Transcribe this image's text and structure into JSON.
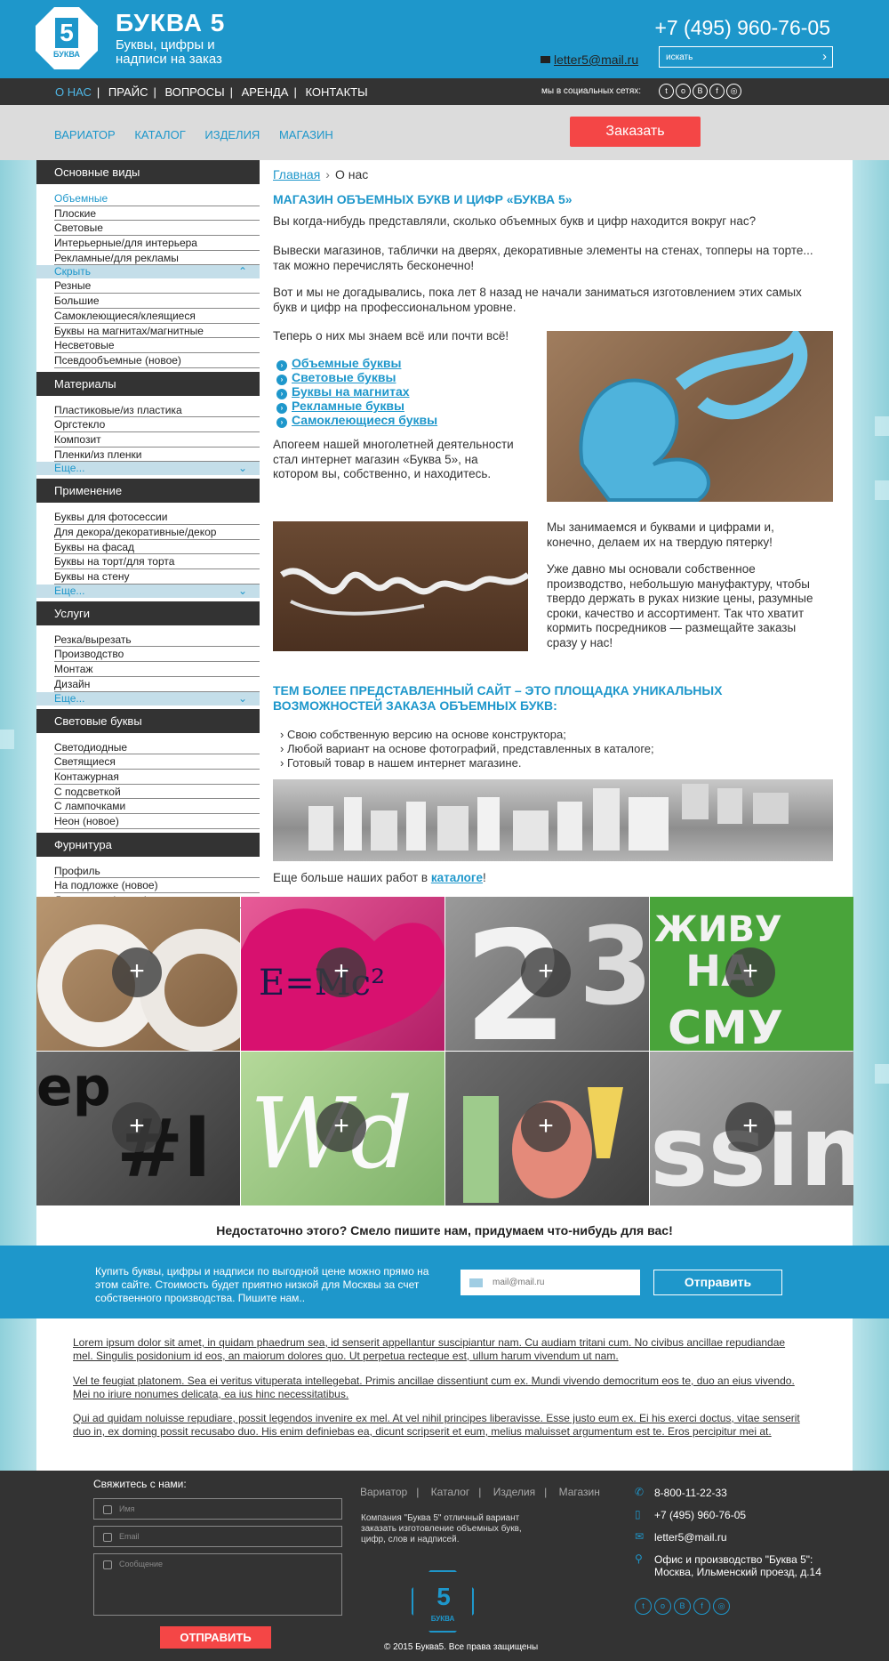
{
  "header": {
    "brand_title": "БУКВА 5",
    "brand_subtitle": "Буквы, цифры и надписи на заказ",
    "logo_digit": "5",
    "logo_label": "БУКВА",
    "phone": "+7 (495) 960-76-05",
    "email": "letter5@mail.ru",
    "search_placeholder": "искать"
  },
  "topnav": {
    "items": [
      "О НАС",
      "ПРАЙС",
      "ВОПРОСЫ",
      "АРЕНДА",
      "КОНТАКТЫ"
    ],
    "social_label": "мы в социальных сетях:",
    "social": [
      "t",
      "о",
      "В",
      "f",
      "◎"
    ]
  },
  "subnav": {
    "items": [
      "ВАРИАТОР",
      "КАТАЛОГ",
      "ИЗДЕЛИЯ",
      "МАГАЗИН"
    ],
    "order": "Заказать"
  },
  "sidebar": {
    "sections": [
      {
        "title": "Основные виды",
        "items": [
          "Объемные",
          "Плоские",
          "Световые",
          "Интерьерные/для интерьера",
          "Рекламные/для рекламы"
        ],
        "more": "Скрыть",
        "extra": [
          "Резные",
          "Большие",
          "Самоклеющиеся/клеящиеся",
          "Буквы на магнитах/магнитные",
          "Несветовые",
          "Псевдообъемные (новое)"
        ]
      },
      {
        "title": "Материалы",
        "items": [
          "Пластиковые/из пластика",
          "Оргстекло",
          "Композит",
          "Пленки/из пленки"
        ],
        "more": "Еще..."
      },
      {
        "title": "Применение",
        "items": [
          "Буквы для фотосессии",
          "Для декора/декоративные/декор",
          "Буквы на фасад",
          "Буквы на торт/для торта",
          "Буквы на стену"
        ],
        "more": "Еще..."
      },
      {
        "title": "Услуги",
        "items": [
          "Резка/вырезать",
          "Производство",
          "Монтаж",
          "Дизайн"
        ],
        "more": "Еще..."
      },
      {
        "title": "Световые буквы",
        "items": [
          "Светодиодные",
          "Светящиеся",
          "Контажурная",
          "С подсветкой",
          "С лампочками",
          "Неон (новое)"
        ]
      },
      {
        "title": "Фурнитура",
        "items": [
          "Профиль",
          "На подложке (новое)",
          "Держатели (новое)"
        ]
      }
    ]
  },
  "main": {
    "breadcrumb_home": "Главная",
    "breadcrumb_sep": "›",
    "breadcrumb_current": "О нас",
    "heading": "МАГАЗИН ОБЪЕМНЫХ БУКВ И ЦИФР «БУКВА 5»",
    "p1": "Вы когда-нибудь представляли, сколько объемных букв и цифр находится вокруг нас?",
    "p2": "Вывески магазинов, таблички на дверях, декоративные элементы на стенах, топперы на торте... так можно перечислять бесконечно!",
    "p3": "Вот и мы не догадывались, пока лет 8 назад не начали заниматься изготовлением этих самых букв и цифр на профессиональном уровне.",
    "p4": "Теперь о них мы знаем всё или почти всё!",
    "links": [
      "Объемные буквы",
      "Световые буквы",
      "Буквы на магнитах",
      "Рекламные буквы",
      "Самоклеющиеся буквы"
    ],
    "p5": "Апогеем нашей многолетней деятельности стал интернет магазин «Буква 5», на котором вы, собственно, и находитесь.",
    "p6": "Мы занимаемся и буквами и цифрами и, конечно, делаем их на твердую пятерку!",
    "p7": "Уже давно мы основали собственное производство, небольшую мануфактуру, чтобы твердо держать в руках низкие цены, разумные сроки, качество и ассортимент. Так что хватит кормить посредников — размещайте заказы сразу у нас!",
    "heading2": "ТЕМ БОЛЕЕ ПРЕДСТАВЛЕННЫЙ САЙТ – ЭТО ПЛОЩАДКА УНИКАЛЬНЫХ ВОЗМОЖНОСТЕЙ ЗАКАЗА ОБЪЕМНЫХ БУКВ:",
    "bullets": [
      "Свою собственную версию на основе конструктора;",
      "Любой вариант на основе фотографий, представленных в каталоге;",
      "Готовый товар в нашем интернет магазине."
    ],
    "catalog_text": "Еще больше наших работ в ",
    "catalog_link": "каталоге",
    "catalog_end": "!"
  },
  "gallery": {
    "plus": "+",
    "cta": "Недостаточно этого? Смело пишите нам, придумаем что-нибудь для вас!"
  },
  "band": {
    "text": "Купить буквы, цифры и надписи по выгодной цене можно прямо на этом сайте. Стоимость будет приятно низкой для Москвы за счет собственного производства. Пишите нам..",
    "placeholder": "mail@mail.ru",
    "button": "Отправить"
  },
  "lorem": [
    "Lorem ipsum dolor sit amet, in quidam phaedrum sea, id senserit appellantur suscipiantur nam. Cu audiam tritani cum. No civibus ancillae repudiandae mel. Singulis posidonium id eos, an maiorum dolores quo. Ut perpetua recteque est, ullum harum vivendum ut nam.",
    "Vel te feugiat platonem. Sea ei veritus vituperata intellegebat. Primis ancillae dissentiunt cum ex. Mundi vivendo democritum eos te, duo an eius vivendo. Mei no iriure nonumes delicata, ea ius hinc necessitatibus.",
    "Qui ad quidam noluisse repudiare, possit legendos invenire ex mel. At vel nihil principes liberavisse. Esse justo eum ex. Ei his exerci doctus, vitae senserit duo in, ex doming possit recusabo duo. His enim definiebas ea, dicunt scripserit et eum, melius maluisset argumentum est te. Eros percipitur mei at."
  ],
  "footer": {
    "contact_label": "Свяжитесь с нами:",
    "name_ph": "Имя",
    "email_ph": "Email",
    "msg_ph": "Сообщение",
    "send": "ОТПРАВИТЬ",
    "nav": [
      "Вариатор",
      "Каталог",
      "Изделия",
      "Магазин"
    ],
    "nav_sep": "|",
    "desc": "Компания \"Буква 5\" отличный вариант заказать изготовление объемных букв, цифр, слов и надписей.",
    "copyright": "© 2015 Буква5. Все права защищены",
    "phone1": "8-800-11-22-33",
    "phone2": "+7 (495) 960-76-05",
    "email": "letter5@mail.ru",
    "address": "Офис и производство \"Буква 5\": Москва, Ильменский проезд, д.14"
  },
  "colors": {
    "accent": "#1e97cb",
    "dark": "#333333",
    "cta_red": "#f44646"
  }
}
